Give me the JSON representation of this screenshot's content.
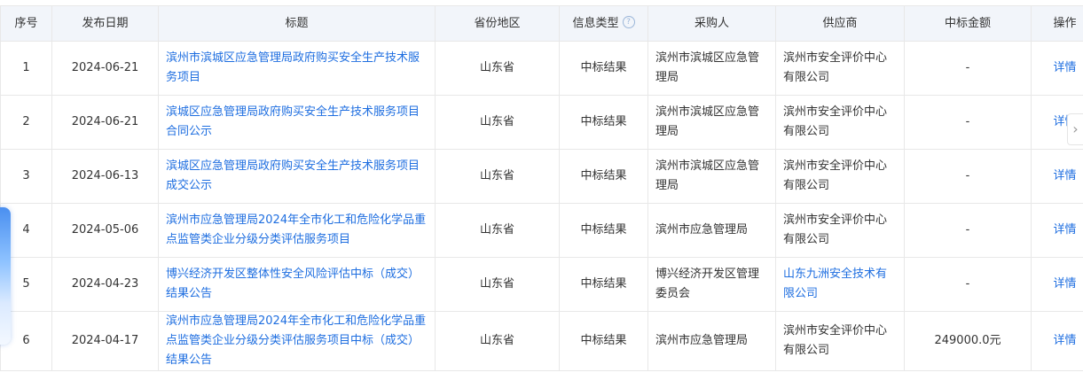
{
  "columns": {
    "index": "序号",
    "date": "发布日期",
    "title": "标题",
    "region": "省份地区",
    "info_type": "信息类型",
    "buyer": "采购人",
    "supplier": "供应商",
    "amount": "中标金额",
    "action": "操作"
  },
  "icons": {
    "info_type_help": "question-circle-icon",
    "scroll_right": "chevron-right-icon"
  },
  "colors": {
    "link": "#1e6ee0",
    "header_bg": "#f2f5fa",
    "border": "#e8e8e8"
  },
  "rows": [
    {
      "index": "1",
      "date": "2024-06-21",
      "title": "滨州市滨城区应急管理局政府购买安全生产技术服务项目",
      "region": "山东省",
      "info_type": "中标结果",
      "buyer": "滨州市滨城区应急管理局",
      "supplier": "滨州市安全评价中心有限公司",
      "supplier_link": false,
      "amount": "-",
      "action": "详情"
    },
    {
      "index": "2",
      "date": "2024-06-21",
      "title": "滨城区应急管理局政府购买安全生产技术服务项目合同公示",
      "region": "山东省",
      "info_type": "中标结果",
      "buyer": "滨州市滨城区应急管理局",
      "supplier": "滨州市安全评价中心有限公司",
      "supplier_link": false,
      "amount": "-",
      "action": "详情"
    },
    {
      "index": "3",
      "date": "2024-06-13",
      "title": "滨城区应急管理局政府购买安全生产技术服务项目成交公示",
      "region": "山东省",
      "info_type": "中标结果",
      "buyer": "滨州市滨城区应急管理局",
      "supplier": "滨州市安全评价中心有限公司",
      "supplier_link": false,
      "amount": "-",
      "action": "详情"
    },
    {
      "index": "4",
      "date": "2024-05-06",
      "title": "滨州市应急管理局2024年全市化工和危险化学品重点监管类企业分级分类评估服务项目",
      "region": "山东省",
      "info_type": "中标结果",
      "buyer": "滨州市应急管理局",
      "supplier": "滨州市安全评价中心有限公司",
      "supplier_link": false,
      "amount": "-",
      "action": "详情"
    },
    {
      "index": "5",
      "date": "2024-04-23",
      "title": "博兴经济开发区整体性安全风险评估中标（成交）结果公告",
      "region": "山东省",
      "info_type": "中标结果",
      "buyer": "博兴经济开发区管理委员会",
      "supplier": "山东九洲安全技术有限公司",
      "supplier_link": true,
      "amount": "-",
      "action": "详情"
    },
    {
      "index": "6",
      "date": "2024-04-17",
      "title": "滨州市应急管理局2024年全市化工和危险化学品重点监管类企业分级分类评估服务项目中标（成交）结果公告",
      "region": "山东省",
      "info_type": "中标结果",
      "buyer": "滨州市应急管理局",
      "supplier": "滨州市安全评价中心有限公司",
      "supplier_link": false,
      "amount": "249000.0元",
      "action": "详情"
    }
  ]
}
